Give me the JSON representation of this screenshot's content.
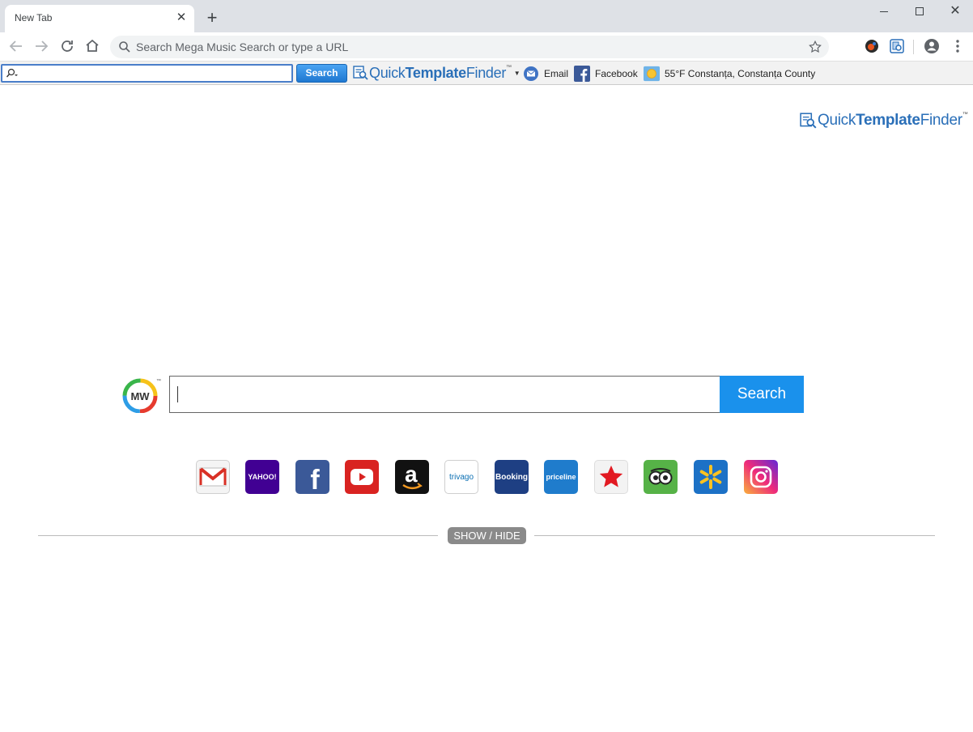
{
  "browser": {
    "tab_title": "New Tab",
    "omnibox_placeholder": "Search Mega Music Search or type a URL"
  },
  "extension_bar": {
    "search_button": "Search",
    "brand": {
      "quick": "Quick",
      "template": "Template",
      "finder": "Finder",
      "tm": "™"
    },
    "email_label": "Email",
    "facebook_label": "Facebook",
    "weather_label": "55°F Constanța, Constanța County"
  },
  "page": {
    "brand": {
      "quick": "Quick",
      "template": "Template",
      "finder": "Finder",
      "tm": "™"
    },
    "search_button": "Search",
    "mw_logo_text": "MW",
    "mw_tm": "™",
    "show_hide_label": "SHOW / HIDE",
    "shortcuts": [
      {
        "name": "gmail-icon",
        "label": ""
      },
      {
        "name": "yahoo-icon",
        "label": "YAHOO!"
      },
      {
        "name": "facebook-icon",
        "label": "f"
      },
      {
        "name": "youtube-icon",
        "label": ""
      },
      {
        "name": "amazon-icon",
        "label": "a"
      },
      {
        "name": "trivago-icon",
        "label": "trivago"
      },
      {
        "name": "booking-icon",
        "label": "Booking"
      },
      {
        "name": "priceline-icon",
        "label": "priceline"
      },
      {
        "name": "macys-star-icon",
        "label": ""
      },
      {
        "name": "tripadvisor-icon",
        "label": ""
      },
      {
        "name": "walmart-icon",
        "label": ""
      },
      {
        "name": "instagram-icon",
        "label": ""
      }
    ]
  },
  "colors": {
    "accent_blue": "#1a91ec",
    "brand_blue": "#2a6fb8",
    "tab_strip": "#dee1e6"
  }
}
